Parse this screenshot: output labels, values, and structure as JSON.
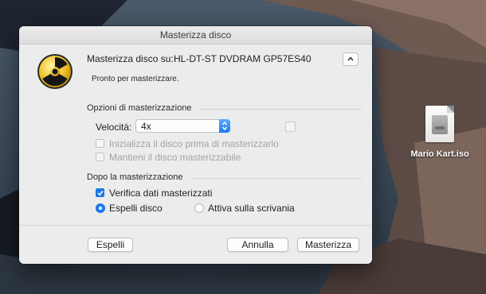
{
  "window": {
    "title": "Masterizza disco"
  },
  "header": {
    "disk_label": "Masterizza disco su:",
    "disk_name": "HL-DT-ST DVDRAM GP57ES40",
    "status": "Pronto per masterizzare."
  },
  "burn_options": {
    "title": "Opzioni di masterizzazione",
    "speed_label": "Velocità:",
    "speed_value": "4x",
    "initialize_label": "Inizializza il disco prima di masterizzarlo",
    "keep_burnable_label": "Mantieni il disco masterizzabile"
  },
  "after_burn": {
    "title": "Dopo la masterizzazione",
    "verify_label": "Verifica dati masterizzati",
    "verify_checked": true,
    "eject_label": "Espelli disco",
    "mount_label": "Attiva sulla scrivania",
    "selected": "eject"
  },
  "buttons": {
    "eject": "Espelli",
    "cancel": "Annulla",
    "burn": "Masterizza"
  },
  "desktop": {
    "file_name": "Mario Kart.iso"
  },
  "colors": {
    "accent": "#1d7bf0",
    "dialog_bg": "#ececec"
  }
}
